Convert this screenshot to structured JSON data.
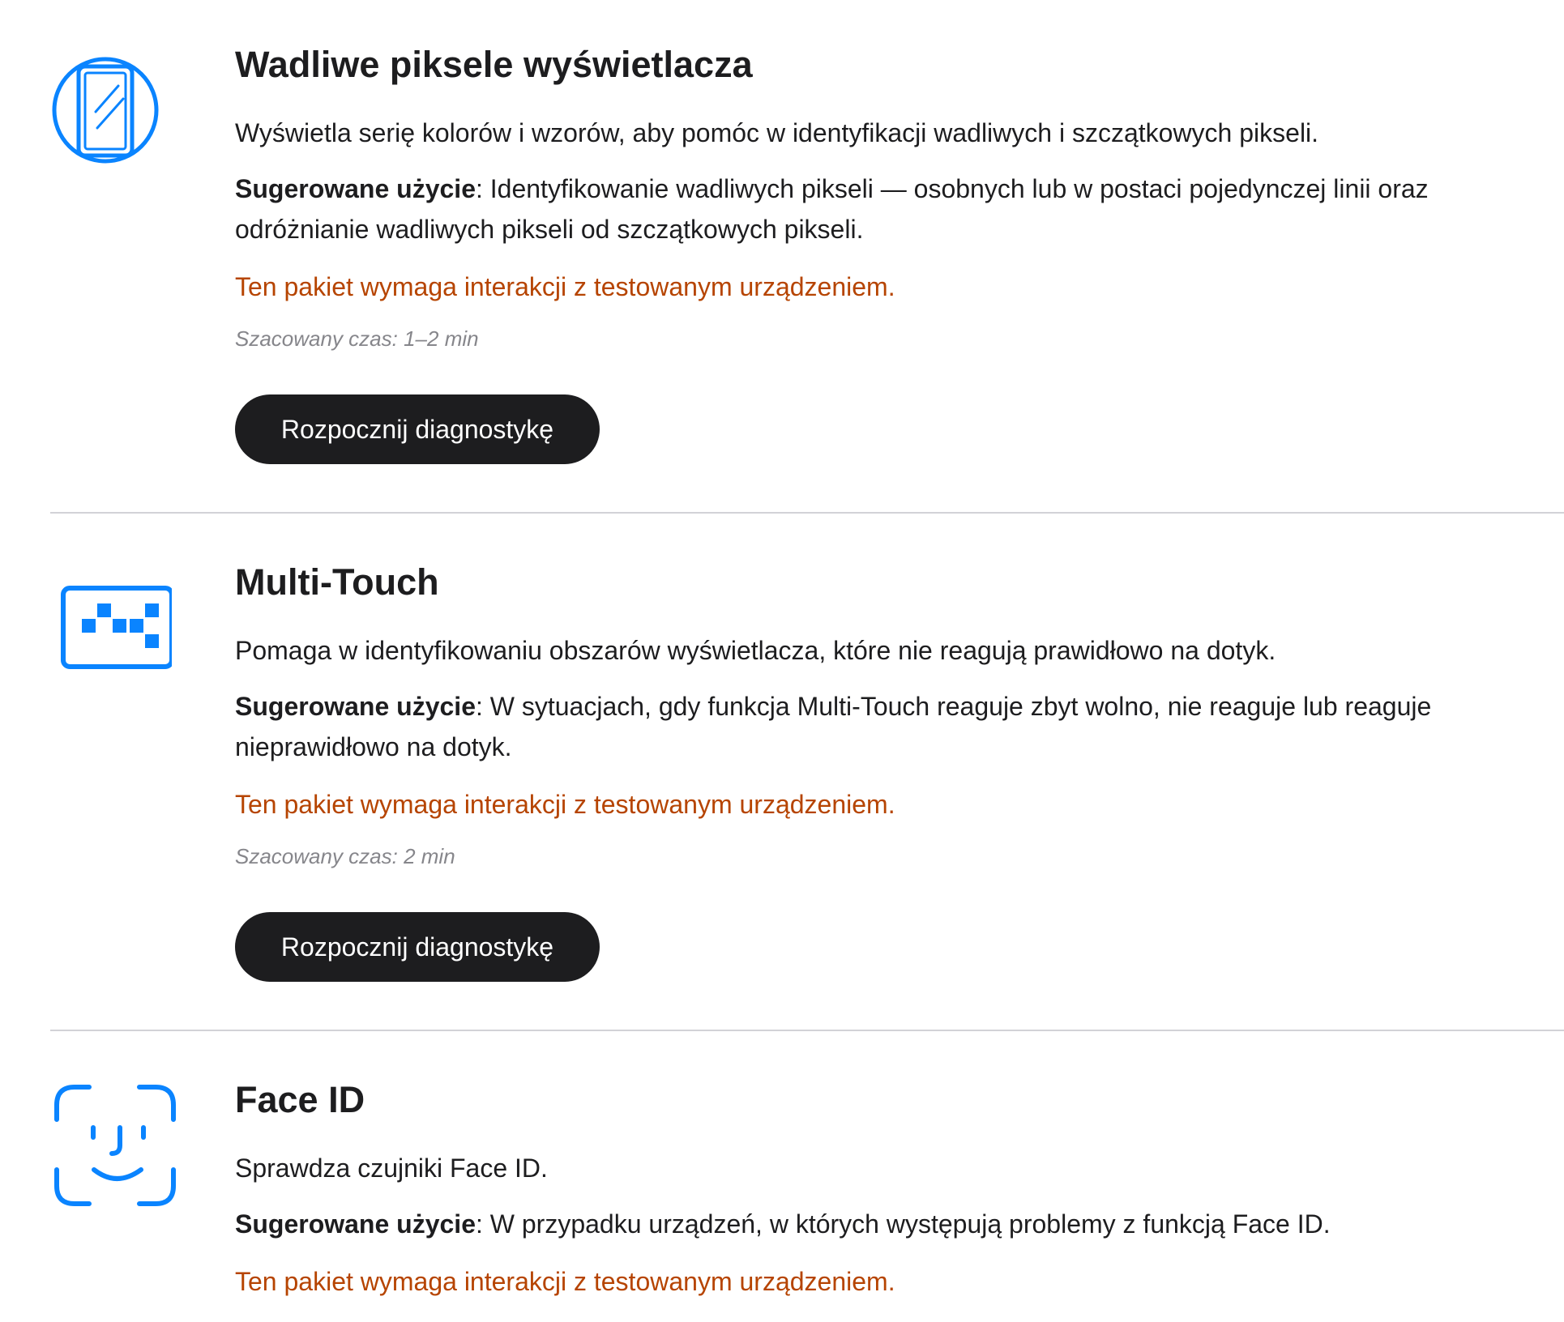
{
  "colors": {
    "icon_blue": "#0a84ff",
    "warning": "#b64400",
    "button_bg": "#1d1d1f",
    "muted": "#86868b"
  },
  "sections": [
    {
      "icon": "display-pixels-icon",
      "title": "Wadliwe piksele wyświetlacza",
      "description": "Wyświetla serię kolorów i wzorów, aby pomóc w identyfikacji wadliwych i szczątkowych pikseli.",
      "usage_label": "Sugerowane użycie",
      "usage_text": ": Identyfikowanie wadliwych pikseli — osobnych lub w postaci pojedynczej linii oraz odróżnianie wadliwych pikseli od szczątkowych pikseli.",
      "warning": "Ten pakiet wymaga interakcji z testowanym urządzeniem.",
      "time": "Szacowany czas: 1–2 min",
      "button": "Rozpocznij diagnostykę"
    },
    {
      "icon": "multi-touch-icon",
      "title": "Multi-Touch",
      "description": "Pomaga w identyfikowaniu obszarów wyświetlacza, które nie reagują prawidłowo na dotyk.",
      "usage_label": "Sugerowane użycie",
      "usage_text": ": W sytuacjach, gdy funkcja Multi-Touch reaguje zbyt wolno, nie reaguje lub reaguje nieprawidłowo na dotyk.",
      "warning": "Ten pakiet wymaga interakcji z testowanym urządzeniem.",
      "time": "Szacowany czas: 2 min",
      "button": "Rozpocznij diagnostykę"
    },
    {
      "icon": "face-id-icon",
      "title": "Face ID",
      "description": "Sprawdza czujniki Face ID.",
      "usage_label": "Sugerowane użycie",
      "usage_text": ": W przypadku urządzeń, w których występują problemy z funkcją Face ID.",
      "warning": "Ten pakiet wymaga interakcji z testowanym urządzeniem."
    }
  ]
}
